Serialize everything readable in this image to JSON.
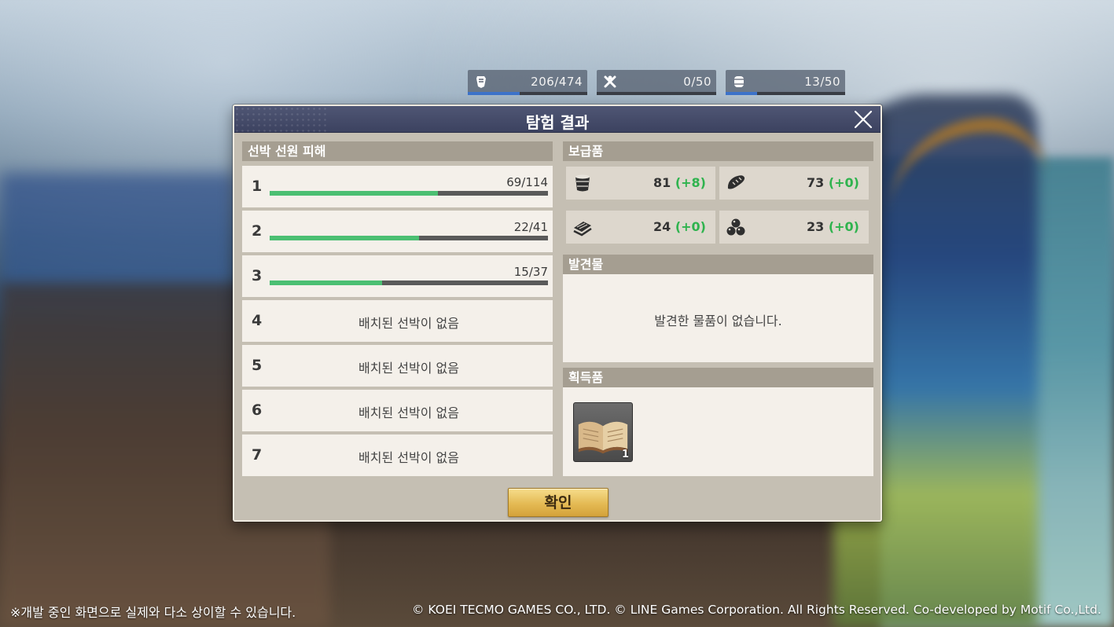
{
  "resources": [
    {
      "icon": "shield-icon",
      "current": "206",
      "max": "474",
      "fill": 0.435
    },
    {
      "icon": "crossed-tools-icon",
      "current": "0",
      "max": "50",
      "fill": 0.0
    },
    {
      "icon": "barrel-icon",
      "current": "13",
      "max": "50",
      "fill": 0.26
    }
  ],
  "dialog": {
    "title": "탐험 결과",
    "ship_section_title": "선박 선원 피해",
    "ships": [
      {
        "num": "1",
        "value": "69/114",
        "fill": 0.605
      },
      {
        "num": "2",
        "value": "22/41",
        "fill": 0.537
      },
      {
        "num": "3",
        "value": "15/37",
        "fill": 0.405
      },
      {
        "num": "4",
        "empty": "배치된 선박이 없음"
      },
      {
        "num": "5",
        "empty": "배치된 선박이 없음"
      },
      {
        "num": "6",
        "empty": "배치된 선박이 없음"
      },
      {
        "num": "7",
        "empty": "배치된 선박이 없음"
      }
    ],
    "supply_section_title": "보급품",
    "supplies": [
      {
        "icon": "water-barrel-icon",
        "value": "81",
        "delta": "(+8)"
      },
      {
        "icon": "bread-icon",
        "value": "73",
        "delta": "(+0)"
      },
      {
        "icon": "lumber-icon",
        "value": "24",
        "delta": "(+0)"
      },
      {
        "icon": "cannonball-icon",
        "value": "23",
        "delta": "(+0)"
      }
    ],
    "discovery_section_title": "발견물",
    "discovery_empty": "발견한 물품이 없습니다.",
    "acquired_section_title": "획득품",
    "acquired_items": [
      {
        "icon": "book-icon",
        "count": "1"
      }
    ],
    "confirm_label": "확인"
  },
  "footer": {
    "notice": "※개발 중인 화면으로 실제와 다소 상이할 수 있습니다.",
    "copyright": "© KOEI TECMO GAMES CO., LTD. © LINE Games Corporation. All Rights Reserved. Co-developed by Motif Co.,Ltd."
  },
  "colors": {
    "progress_green": "#4bbf72",
    "resource_blue": "#3d73c9",
    "delta_green": "#2fb34e",
    "header_navy": "#3c4260",
    "confirm_gold": "#e4ba54"
  }
}
